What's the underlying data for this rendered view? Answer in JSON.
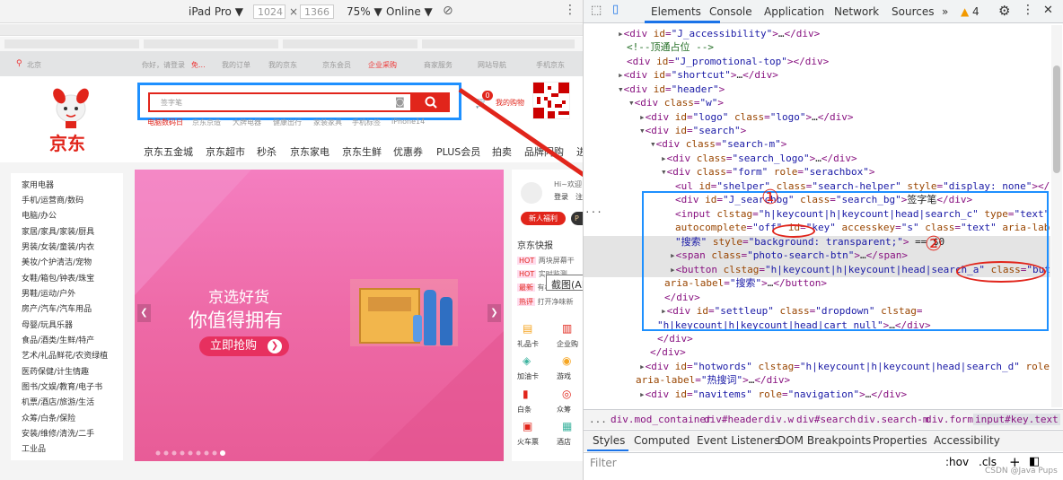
{
  "device_toolbar": {
    "device": "iPad Pro",
    "width": "1024",
    "times": "×",
    "height": "1366",
    "zoom": "75%",
    "network": "Online"
  },
  "jd": {
    "location": "北京",
    "shortcut_links": [
      "你好，请登录",
      "免...",
      "我的订单",
      "我的京东",
      "京东会员",
      "企业采购",
      "商家服务",
      "网站导航",
      "手机京东"
    ],
    "logo_text": "京东",
    "search_placeholder": "签字笔",
    "cart_count": "0",
    "cart_label": "我的购物",
    "hotwords": [
      "电脑数码日",
      "京东京造",
      "大牌电器",
      "健康出行",
      "家装家具",
      "手机标签",
      "iPhone14"
    ],
    "nav_items": [
      "京东五金城",
      "京东超市",
      "秒杀",
      "京东家电",
      "京东生鲜",
      "优惠券",
      "PLUS会员",
      "拍卖",
      "品牌闪购",
      "进"
    ],
    "categories": [
      "家用电器",
      "手机/运营商/数码",
      "电脑/办公",
      "家居/家具/家装/厨具",
      "男装/女装/童装/内衣",
      "美妆/个护清洁/宠物",
      "女鞋/箱包/钟表/珠宝",
      "男鞋/运动/户外",
      "房产/汽车/汽车用品",
      "母婴/玩具乐器",
      "食品/酒类/生鲜/特产",
      "艺术/礼品鲜花/农资绿植",
      "医药保健/计生情趣",
      "图书/文娱/教育/电子书",
      "机票/酒店/旅游/生活",
      "众筹/白条/保险",
      "安装/维修/清洗/二手",
      "工业品"
    ],
    "banner": {
      "line1": "京选好货",
      "line2": "你值得拥有",
      "button": "立即抢购",
      "button_icon": "chevron-right-icon"
    },
    "user": {
      "greeting": "Hi~欢迎",
      "login": "登录",
      "register": "注",
      "newcomer": "新人福利",
      "plus": "P"
    },
    "news": {
      "title": "京东快报",
      "items": [
        {
          "tag": "HOT",
          "text": "两块屏幕干"
        },
        {
          "tag": "HOT",
          "text": "实时监测"
        },
        {
          "tag": "最新",
          "text": "有机蔬菜"
        },
        {
          "tag": "热评",
          "text": "打开净味新"
        }
      ]
    },
    "tooltip": "截图(Alt + A)",
    "services": [
      "礼品卡",
      "企业购",
      "加油卡",
      "游戏",
      "白条",
      "众筹",
      "火车票",
      "酒店"
    ]
  },
  "devtools": {
    "tabs": [
      "Elements",
      "Console",
      "Application",
      "Network",
      "Sources"
    ],
    "more": "»",
    "warnings": "4",
    "annotations": {
      "one": "①",
      "two": "②"
    },
    "breadcrumbs": [
      "...",
      "div.mod_container",
      "div#header",
      "div.w",
      "div#search",
      "div.search-m",
      "div.form",
      "input#key.text"
    ],
    "style_tabs": [
      "Styles",
      "Computed",
      "Event Listeners",
      "DOM Breakpoints",
      "Properties",
      "Accessibility"
    ],
    "filter_placeholder": "Filter",
    "hov": ":hov",
    ".cls": ".cls",
    "plus": "+",
    "watermark": "CSDN @Java Pups"
  }
}
